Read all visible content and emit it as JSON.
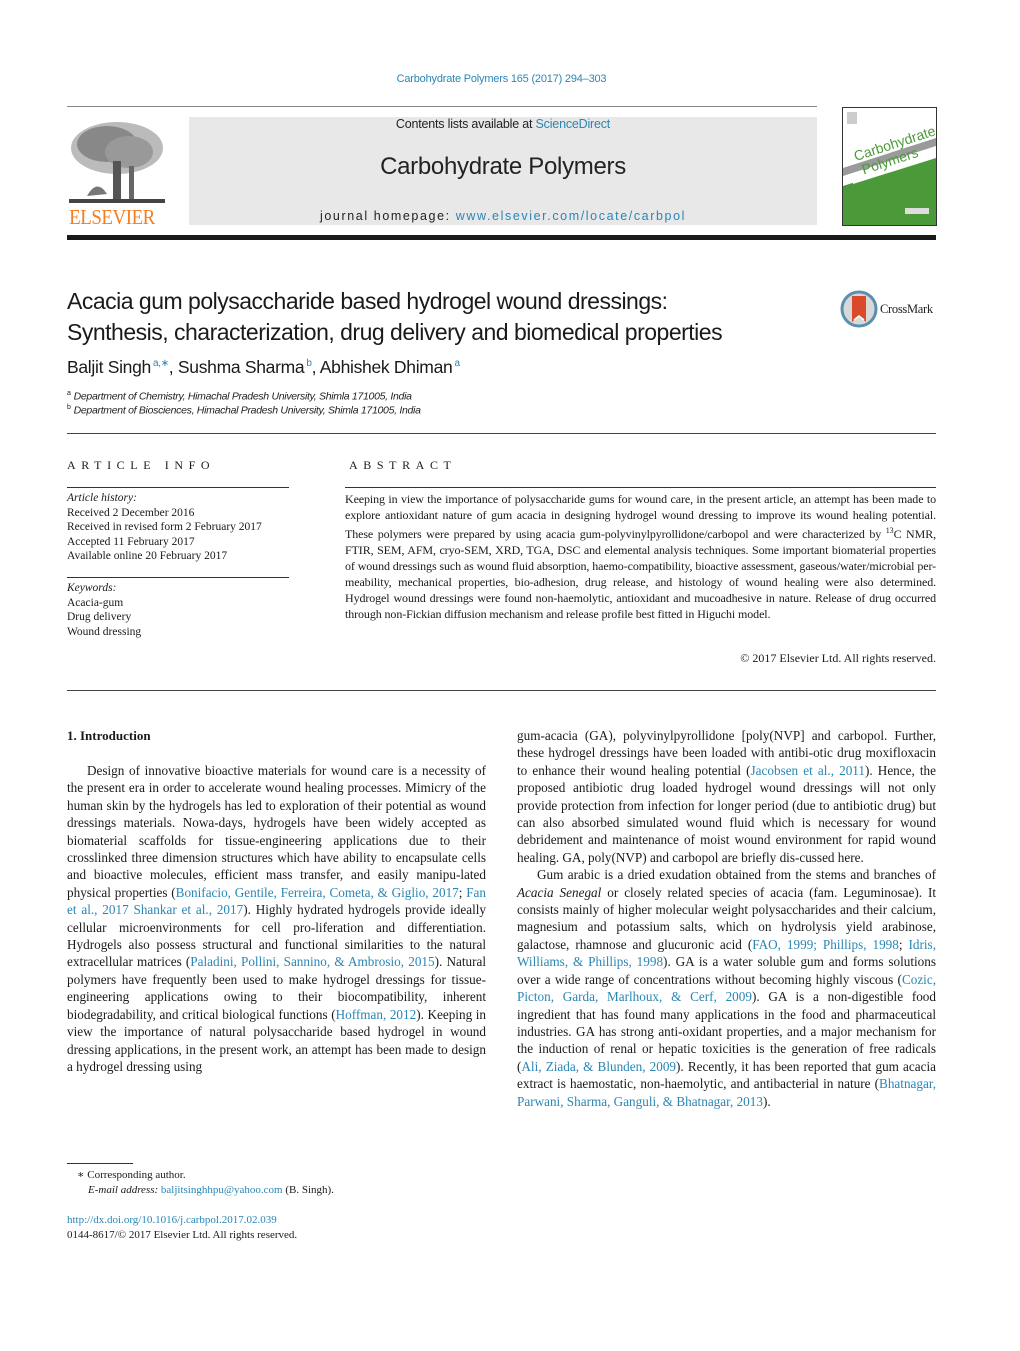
{
  "header": {
    "citation": "Carbohydrate Polymers 165 (2017) 294–303",
    "contents_prefix": "Contents lists available at ",
    "contents_link": "ScienceDirect",
    "journal_title": "Carbohydrate Polymers",
    "homepage_prefix": "journal homepage: ",
    "homepage_link": "www.elsevier.com/locate/carbpol",
    "publisher_logo_text": "ELSEVIER",
    "cover": {
      "title_line1": "Carbohydrate",
      "title_line2": "Polymers",
      "colors": {
        "green": "#4a9a3a",
        "grey": "#9a9a9a"
      }
    }
  },
  "article": {
    "title_line1": "Acacia gum polysaccharide based hydrogel wound dressings:",
    "title_line2": "Synthesis, characterization, drug delivery and biomedical properties",
    "crossmark_label": "CrossMark",
    "authors": [
      {
        "name": "Baljit Singh",
        "affil": "a,∗"
      },
      {
        "name": "Sushma Sharma",
        "affil": "b"
      },
      {
        "name": "Abhishek Dhiman",
        "affil": "a"
      }
    ],
    "affiliations": [
      {
        "mark": "a",
        "text": "Department of Chemistry, Himachal Pradesh University, Shimla 171005, India"
      },
      {
        "mark": "b",
        "text": "Department of Biosciences, Himachal Pradesh University, Shimla 171005, India"
      }
    ]
  },
  "article_info": {
    "heading": "ARTICLE INFO",
    "history_label": "Article history:",
    "history": [
      "Received 2 December 2016",
      "Received in revised form 2 February 2017",
      "Accepted 11 February 2017",
      "Available online 20 February 2017"
    ],
    "keywords_label": "Keywords:",
    "keywords": [
      "Acacia-gum",
      "Drug delivery",
      "Wound dressing"
    ]
  },
  "abstract": {
    "heading": "ABSTRACT",
    "text_part1": "Keeping in view the importance of polysaccharide gums for wound care, in the present article, an attempt has been made to explore antioxidant nature of gum acacia in designing hydrogel wound dressing to improve its wound healing potential. These polymers were prepared by using acacia gum-polyvinylpyrollidone/carbopol and were characterized by ",
    "sup": "13",
    "text_part2": "C NMR, FTIR, SEM, AFM, cryo-SEM, XRD, TGA, DSC and elemental analysis techniques. Some important biomaterial properties of wound dressings such as wound fluid absorption, haemo-compatibility, bioactive assessment, gaseous/water/microbial per-meability, mechanical properties, bio-adhesion, drug release, and histology of wound healing were also determined. Hydrogel wound dressings were found non-haemolytic, antioxidant and mucoadhesive in nature. Release of drug occurred through non-Fickian diffusion mechanism and release profile best fitted in Higuchi model.",
    "copyright": "© 2017 Elsevier Ltd. All rights reserved."
  },
  "body": {
    "section_heading": "1.  Introduction",
    "left": {
      "p1_a": "Design of innovative bioactive materials for wound care is a necessity of the present era in order to accelerate wound healing processes. Mimicry of the human skin by the hydrogels has led to exploration of their potential as wound dressings materials. Nowa-days, hydrogels have been widely accepted as biomaterial scaffolds for tissue-engineering applications due to their crosslinked three dimension structures which have ability to encapsulate cells and bioactive molecules, efficient mass transfer, and easily manipu-lated physical properties (",
      "ref1": "Bonifacio, Gentile, Ferreira, Cometa, & Giglio, 2017",
      "sep1": "; ",
      "ref2": "Fan et al., 2017 Shankar et al., 2017",
      "p1_b": "). Highly hydrated hydrogels provide ideally cellular microenvironments for cell pro-liferation and differentiation. Hydrogels also possess structural and functional similarities to the natural extracellular matrices (",
      "ref3": "Paladini, Pollini, Sannino, & Ambrosio, 2015",
      "p1_c": "). Natural polymers have frequently been used to make hydrogel dressings for tissue-engineering applications owing to their biocompatibility, inherent biodegradability, and critical biological functions (",
      "ref4": "Hoffman, 2012",
      "p1_d": "). Keeping in view the importance of natural polysaccharide based hydrogel in wound dressing applications, in the present work, an attempt has been made to design a hydrogel dressing using"
    },
    "right": {
      "p1_a": "gum-acacia (GA), polyvinylpyrollidone [poly(NVP] and carbopol. Further, these hydrogel dressings have been loaded with antibi-otic drug moxifloxacin to enhance their wound healing potential (",
      "ref1": "Jacobsen et al., 2011",
      "p1_b": "). Hence, the proposed antibiotic drug loaded hydrogel wound dressings will not only provide protection from infection for longer period (due to antibiotic drug) but can also absorbed simulated wound fluid which is necessary for wound debridement and maintenance of moist wound environment for rapid wound healing. GA, poly(NVP) and carbopol are briefly dis-cussed here.",
      "p2_a": "Gum arabic is a dried exudation obtained from the stems and branches of ",
      "p2_species": "Acacia Senegal",
      "p2_b": " or closely related species of acacia (fam. Leguminosae). It consists mainly of higher molecular weight polysaccharides and their calcium, magnesium and potassium salts, which on hydrolysis yield arabinose, galactose, rhamnose and glucuronic acid (",
      "ref2": "FAO, 1999; Phillips, 1998",
      "sep2": "; ",
      "ref3": "Idris, Williams, & Phillips, 1998",
      "p2_c": "). GA is a water soluble gum and forms solutions over a wide range of concentrations without becoming highly viscous (",
      "ref4": "Cozic, Picton, Garda, Marlhoux, & Cerf, 2009",
      "p2_d": "). GA is a non-digestible food ingredient that has found many applications in the food and pharmaceutical industries. GA has strong anti-oxidant properties, and a major mechanism for the induction of renal or hepatic toxicities is the generation of free radicals (",
      "ref5": "Ali, Ziada, & Blunden, 2009",
      "p2_e": "). Recently, it has been reported that gum acacia extract is haemostatic, non-haemolytic, and antibacterial in nature (",
      "ref6": "Bhatnagar, Parwani, Sharma, Ganguli, & Bhatnagar, 2013",
      "p2_f": ")."
    }
  },
  "footer": {
    "fn_mark": "∗",
    "fn_text": " Corresponding author.",
    "email_label": "E-mail address: ",
    "email": "baljitsinghhpu@yahoo.com",
    "email_suffix": " (B. Singh).",
    "doi": "http://dx.doi.org/10.1016/j.carbpol.2017.02.039",
    "issn": "0144-8617/© 2017 Elsevier Ltd. All rights reserved."
  },
  "colors": {
    "link": "#2a86b4",
    "elsevier_orange": "#f47d20",
    "masthead_bg": "#e8e8e8"
  }
}
